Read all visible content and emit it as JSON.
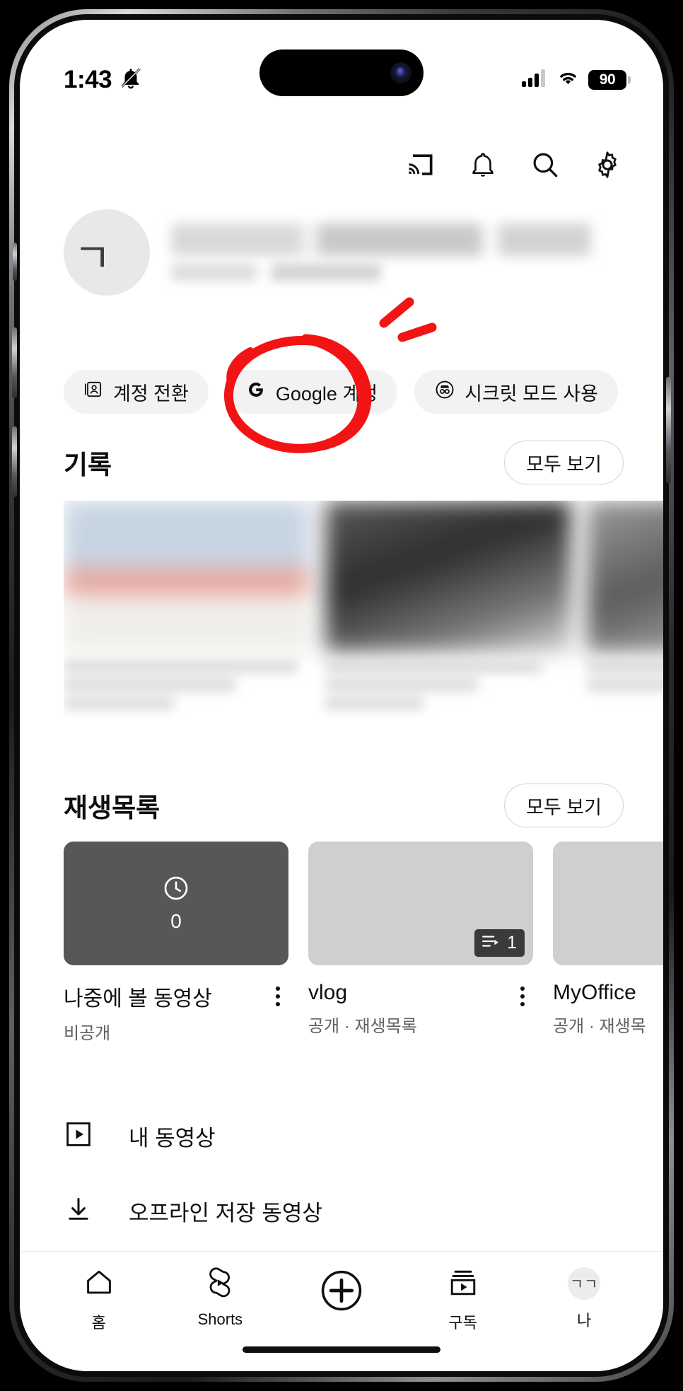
{
  "status_bar": {
    "time": "1:43",
    "silent_icon": "bell-muted-icon",
    "cellular_icon": "cellular-bars-icon",
    "wifi_icon": "wifi-icon",
    "battery_level": "90"
  },
  "app_header": {
    "icons": [
      {
        "name": "cast-icon",
        "label": "Cast"
      },
      {
        "name": "bell-icon",
        "label": "Notifications"
      },
      {
        "name": "search-icon",
        "label": "Search"
      },
      {
        "name": "gear-icon",
        "label": "Settings"
      }
    ]
  },
  "profile": {
    "avatar_text": "ㄱㄱ",
    "name": "",
    "handle": ""
  },
  "chips": [
    {
      "icon": "switch-account-icon",
      "label": "계정 전환"
    },
    {
      "icon": "google-g-icon",
      "label": "Google 계정",
      "highlighted": true
    },
    {
      "icon": "incognito-icon",
      "label": "시크릿 모드 사용"
    }
  ],
  "history": {
    "title": "기록",
    "see_all": "모두 보기"
  },
  "playlists": {
    "title": "재생목록",
    "see_all": "모두 보기",
    "items": [
      {
        "title": "나중에 볼 동영상",
        "subtitle": "비공개",
        "count": "0",
        "style": "dark",
        "icon": "clock-icon"
      },
      {
        "title": "vlog",
        "subtitle": "공개 · 재생목록",
        "badge_count": "1",
        "style": "light",
        "badge_icon": "playlist-icon"
      },
      {
        "title": "MyOffice",
        "subtitle": "공개 · 재생목",
        "style": "light"
      }
    ]
  },
  "menu_rows": [
    {
      "icon": "play-square-icon",
      "label": "내 동영상"
    },
    {
      "icon": "download-icon",
      "label": "오프라인 저장 동영상"
    }
  ],
  "tab_bar": [
    {
      "icon": "home-icon",
      "label": "홈"
    },
    {
      "icon": "shorts-icon",
      "label": "Shorts"
    },
    {
      "icon": "plus-circle-icon",
      "label": ""
    },
    {
      "icon": "subscriptions-icon",
      "label": "구독"
    },
    {
      "icon": "account-avatar-icon",
      "label": "나"
    }
  ],
  "annotation": {
    "color": "#f21414",
    "shapes": [
      "circle-around-google-account-chip",
      "emphasis-ticks"
    ]
  }
}
